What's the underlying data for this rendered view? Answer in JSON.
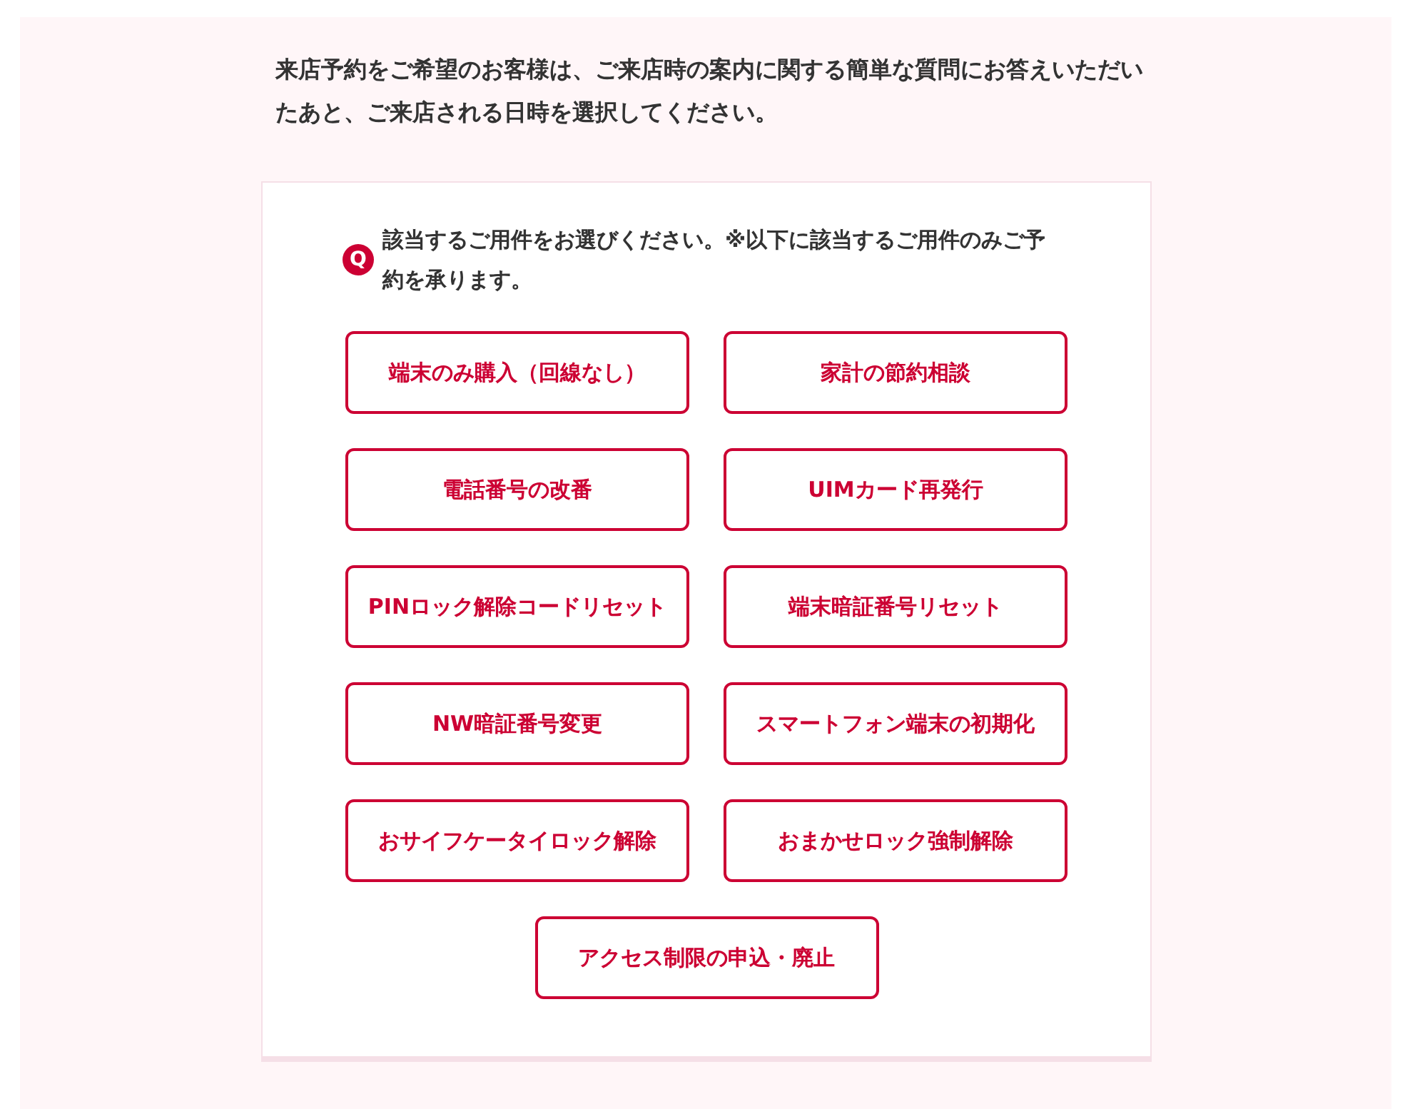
{
  "intro": "来店予約をご希望のお客様は、ご来店時の案内に関する簡単な質問にお答えいただいたあと、ご来店される日時を選択してください。",
  "question": {
    "mark": "Q",
    "text": "該当するご用件をお選びください。※以下に該当するご用件のみご予約を承ります。"
  },
  "options": [
    {
      "label": "端末のみ購入（回線なし）"
    },
    {
      "label": "家計の節約相談"
    },
    {
      "label": "電話番号の改番"
    },
    {
      "label": "UIMカード再発行"
    },
    {
      "label": "PINロック解除コードリセット"
    },
    {
      "label": "端末暗証番号リセット"
    },
    {
      "label": "NW暗証番号変更"
    },
    {
      "label": "スマートフォン端末の初期化"
    },
    {
      "label": "おサイフケータイロック解除"
    },
    {
      "label": "おまかせロック強制解除"
    },
    {
      "label": "アクセス制限の申込・廃止"
    }
  ]
}
